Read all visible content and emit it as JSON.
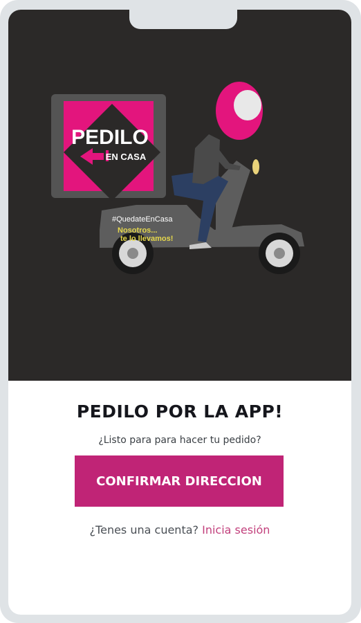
{
  "hero": {
    "logo_text": "PEDILO",
    "logo_subtext": "EN CASA",
    "hashtag": "#QuedateEnCasa",
    "slogan_line1": "Nosotros...",
    "slogan_line2": "te lo llevamos!",
    "colors": {
      "background": "#2b2928",
      "brand_pink": "#e3157d",
      "scooter_gray": "#5d5d5d"
    }
  },
  "main": {
    "title": "PEDILO POR LA APP!",
    "subtitle": "¿Listo para para hacer tu pedido?",
    "confirm_label": "CONFIRMAR DIRECCION",
    "account_prompt": "¿Tenes una cuenta?",
    "login_label": "Inicia sesión"
  },
  "colors": {
    "cta": "#c02476",
    "link": "#c2407c"
  }
}
